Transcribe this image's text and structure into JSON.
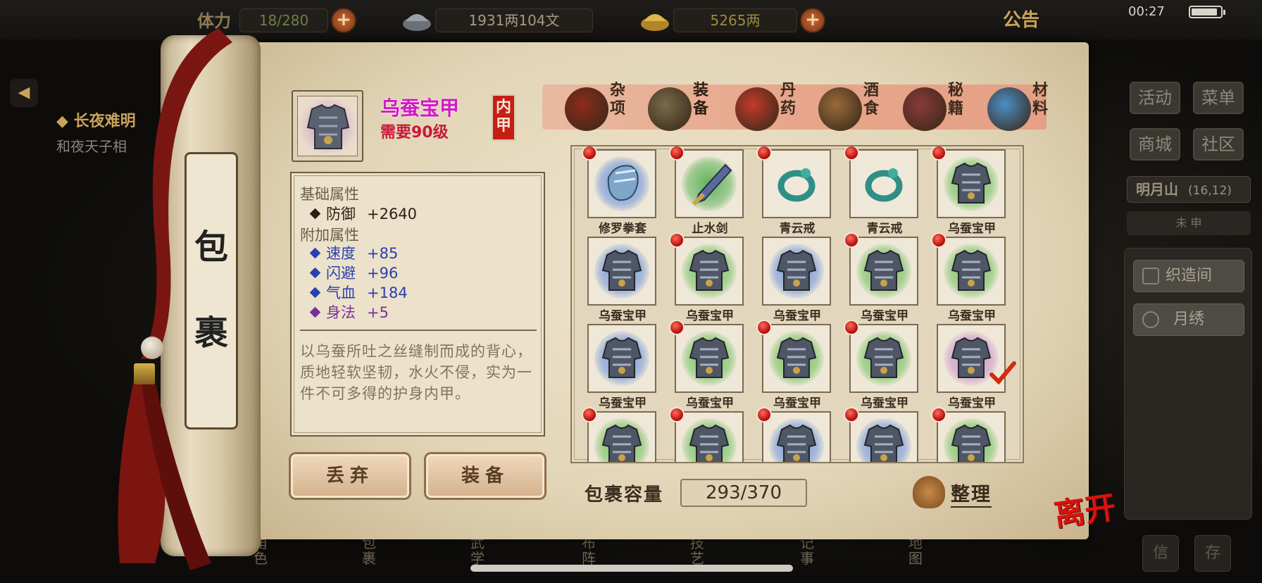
{
  "topbar": {
    "stat_prefix": "体力",
    "stat": "18/280",
    "silver": "1931两104文",
    "gold": "5265两",
    "notice": "公告",
    "time": "00:27"
  },
  "background": {
    "quest_title": "◆ 长夜难明",
    "quest_sub": "和夜天子相",
    "right_buttons": [
      "活动",
      "菜单",
      "商城",
      "社区"
    ],
    "location": "明月山",
    "location_coords": "(16,12)",
    "compass": "未  申",
    "side_buttons": [
      "织造间",
      "月绣"
    ],
    "corner_buttons": [
      "信",
      "存"
    ],
    "bottom_nav": [
      "角色",
      "包裹",
      "武学",
      "布阵",
      "技艺",
      "记事",
      "地图"
    ]
  },
  "scroll": {
    "title_chars": [
      "包",
      "裹"
    ]
  },
  "item": {
    "name": "乌蚕宝甲",
    "requirement": "需要90级",
    "type_seal": "内甲",
    "base_section": "基础属性",
    "base_attrs": [
      {
        "name": "防御",
        "value": "+2640",
        "color": "#2b1f12"
      }
    ],
    "extra_section": "附加属性",
    "extra_attrs": [
      {
        "name": "速度",
        "value": "+85",
        "color": "#2a3fb0"
      },
      {
        "name": "闪避",
        "value": "+96",
        "color": "#2a3fb0"
      },
      {
        "name": "气血",
        "value": "+184",
        "color": "#2a3fb0"
      },
      {
        "name": "身法",
        "value": "+5",
        "color": "#7a2f9a"
      }
    ],
    "description": "以乌蚕所吐之丝缝制而成的背心，质地轻软坚韧，水火不侵，实为一件不可多得的护身内甲。"
  },
  "actions": {
    "discard": "丢弃",
    "equip": "装备"
  },
  "tabs": [
    {
      "label": "杂项",
      "icon": "jar-icon",
      "active": false
    },
    {
      "label": "装备",
      "icon": "equipment-icon",
      "active": true
    },
    {
      "label": "丹药",
      "icon": "pill-icon",
      "active": false
    },
    {
      "label": "酒食",
      "icon": "wine-food-icon",
      "active": false
    },
    {
      "label": "秘籍",
      "icon": "book-icon",
      "active": false
    },
    {
      "label": "材料",
      "icon": "crystal-icon",
      "active": false
    }
  ],
  "inventory": [
    {
      "name": "修罗拳套",
      "kind": "gauntlet",
      "glow": "#6d93d8",
      "new": true
    },
    {
      "name": "止水剑",
      "kind": "sword",
      "glow": "#5fb25a",
      "new": true
    },
    {
      "name": "青云戒",
      "kind": "ring",
      "glow": "#f0e9da",
      "new": true
    },
    {
      "name": "青云戒",
      "kind": "ring",
      "glow": "#f0e9da",
      "new": true
    },
    {
      "name": "乌蚕宝甲",
      "kind": "armor",
      "glow": "#6fbf5a",
      "new": true
    },
    {
      "name": "乌蚕宝甲",
      "kind": "armor",
      "glow": "#6d93d8",
      "new": false
    },
    {
      "name": "乌蚕宝甲",
      "kind": "armor",
      "glow": "#6fbf5a",
      "new": true
    },
    {
      "name": "乌蚕宝甲",
      "kind": "armor",
      "glow": "#6d93d8",
      "new": false
    },
    {
      "name": "乌蚕宝甲",
      "kind": "armor",
      "glow": "#6fbf5a",
      "new": true
    },
    {
      "name": "乌蚕宝甲",
      "kind": "armor",
      "glow": "#6fbf5a",
      "new": true
    },
    {
      "name": "乌蚕宝甲",
      "kind": "armor",
      "glow": "#6d93d8",
      "new": false
    },
    {
      "name": "乌蚕宝甲",
      "kind": "armor",
      "glow": "#6fbf5a",
      "new": true
    },
    {
      "name": "乌蚕宝甲",
      "kind": "armor",
      "glow": "#6fbf5a",
      "new": true
    },
    {
      "name": "乌蚕宝甲",
      "kind": "armor",
      "glow": "#6fbf5a",
      "new": true
    },
    {
      "name": "乌蚕宝甲",
      "kind": "armor",
      "glow": "#c98ec8",
      "new": false,
      "selected": true
    },
    {
      "name": "",
      "kind": "armor",
      "glow": "#6fbf5a",
      "new": true
    },
    {
      "name": "",
      "kind": "armor",
      "glow": "#6fbf5a",
      "new": true
    },
    {
      "name": "",
      "kind": "armor",
      "glow": "#6d93d8",
      "new": true
    },
    {
      "name": "",
      "kind": "armor",
      "glow": "#6d93d8",
      "new": true
    },
    {
      "name": "",
      "kind": "armor",
      "glow": "#6fbf5a",
      "new": true
    }
  ],
  "capacity": {
    "label": "包裹容量",
    "value": "293/370"
  },
  "sort_label": "整理",
  "leave_label": "离开",
  "colors": {
    "item_name": "#d417c9",
    "requirement": "#c8193a",
    "seal": "#c51f14",
    "leave": "#d6140e"
  }
}
